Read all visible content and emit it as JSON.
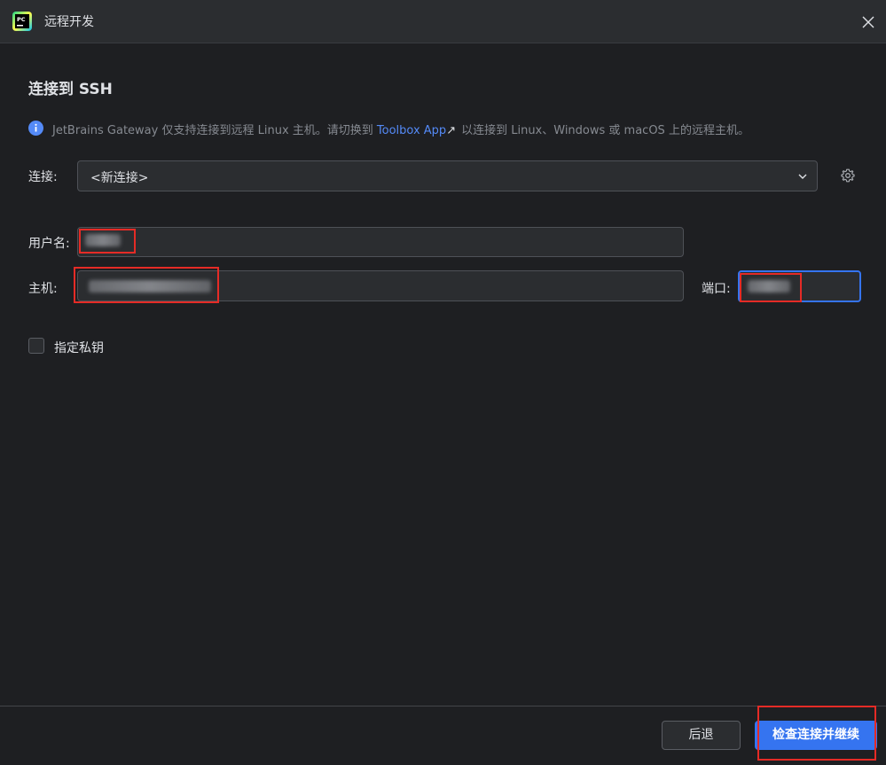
{
  "window": {
    "title": "远程开发",
    "logo_text": "PC"
  },
  "page": {
    "heading": "连接到 SSH"
  },
  "info": {
    "prefix": "JetBrains Gateway 仅支持连接到远程 Linux 主机。请切换到 ",
    "link_text": "Toolbox App",
    "link_arrow": "↗",
    "suffix": "以连接到 Linux、Windows 或 macOS 上的远程主机。"
  },
  "connection": {
    "label": "连接:",
    "selected": "<新连接>"
  },
  "form": {
    "username_label": "用户名:",
    "username_value": "",
    "host_label": "主机:",
    "host_value": "",
    "port_label": "端口:",
    "port_value": ""
  },
  "private_key": {
    "label": "指定私钥",
    "checked": false
  },
  "footer": {
    "back_label": "后退",
    "continue_label": "检查连接并继续"
  },
  "colors": {
    "background": "#1e1f22",
    "panel": "#2b2d30",
    "accent": "#3574f0",
    "link": "#548af7",
    "annotation_red": "#e52b26"
  }
}
